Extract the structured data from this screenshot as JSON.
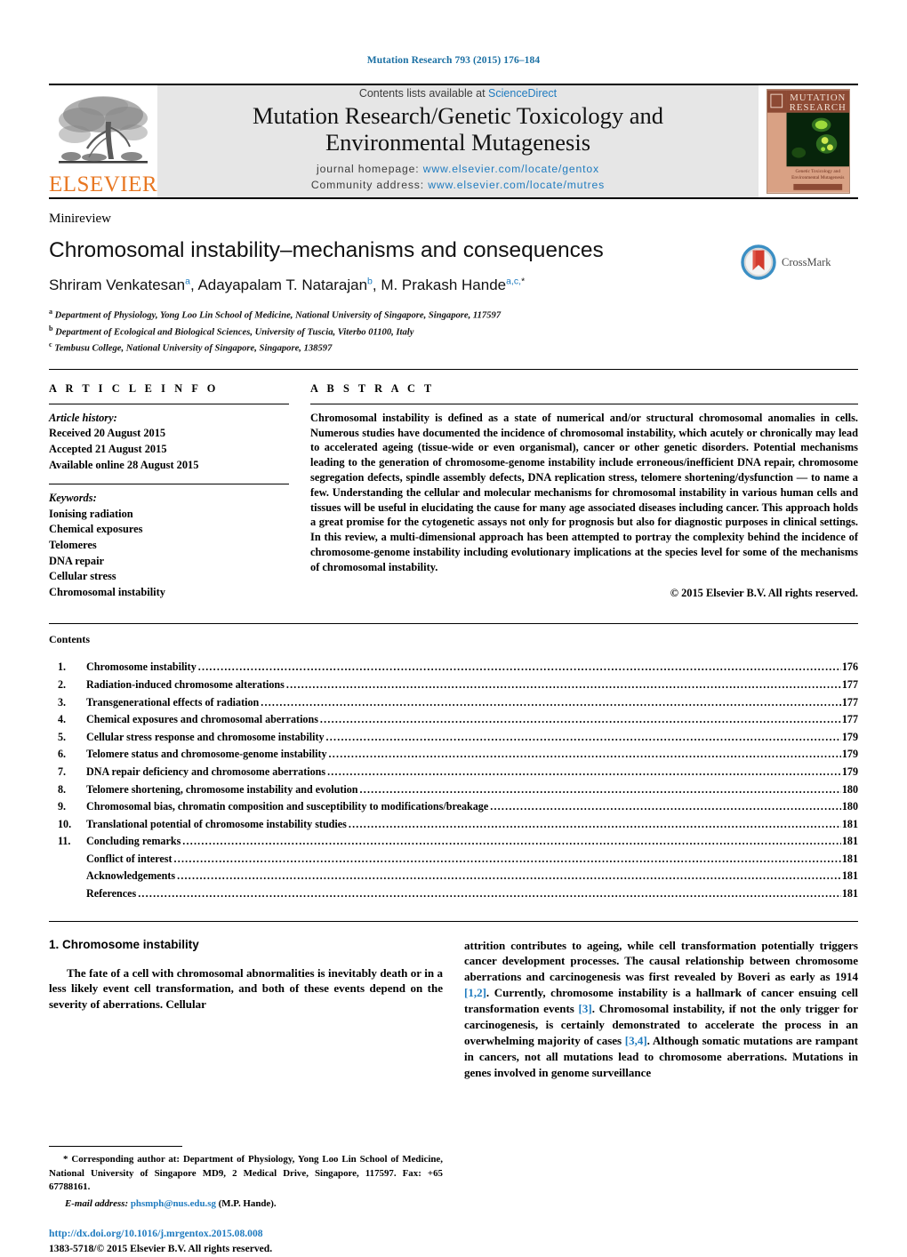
{
  "running_head": "Mutation Research 793 (2015) 176–184",
  "masthead": {
    "publisher_name": "ELSEVIER",
    "contents_prefix": "Contents lists available at ",
    "contents_link": "ScienceDirect",
    "journal_title_line1": "Mutation Research/Genetic Toxicology and",
    "journal_title_line2": "Environmental Mutagenesis",
    "homepage_label": "journal homepage:",
    "homepage_url": "www.elsevier.com/locate/gentox",
    "community_label": "Community address:",
    "community_url": "www.elsevier.com/locate/mutres",
    "cover_title_line1": "MUTATION",
    "cover_title_line2": "RESEARCH",
    "cover_sub_line1": "Genetic Toxicology and",
    "cover_sub_line2": "Environmental Mutagenesis"
  },
  "article": {
    "type_label": "Minireview",
    "title": "Chromosomal instability–mechanisms and consequences",
    "authors": [
      {
        "name": "Shriram Venkatesan",
        "marks": "a",
        "sep": ", "
      },
      {
        "name": "Adayapalam T. Natarajan",
        "marks": "b",
        "sep": ", "
      },
      {
        "name": "M. Prakash Hande",
        "marks": "a,c,",
        "star": "*",
        "sep": ""
      }
    ],
    "affiliations": [
      {
        "mark": "a",
        "text": "Department of Physiology, Yong Loo Lin School of Medicine, National University of Singapore, Singapore, 117597"
      },
      {
        "mark": "b",
        "text": "Department of Ecological and Biological Sciences, University of Tuscia, Viterbo 01100, Italy"
      },
      {
        "mark": "c",
        "text": "Tembusu College, National University of Singapore, Singapore, 138597"
      }
    ],
    "crossmark_label": "CrossMark"
  },
  "article_info": {
    "heading": "A R T I C L E    I N F O",
    "history_label": "Article history:",
    "history": [
      "Received 20 August 2015",
      "Accepted 21 August 2015",
      "Available online 28 August 2015"
    ],
    "keywords_label": "Keywords:",
    "keywords": [
      "Ionising radiation",
      "Chemical exposures",
      "Telomeres",
      "DNA repair",
      "Cellular stress",
      "Chromosomal instability"
    ]
  },
  "abstract": {
    "heading": "A B S T R A C T",
    "text": "Chromosomal instability is defined as a state of numerical and/or structural chromosomal anomalies in cells. Numerous studies have documented the incidence of chromosomal instability, which acutely or chronically may lead to accelerated ageing (tissue-wide or even organismal), cancer or other genetic disorders. Potential mechanisms leading to the generation of chromosome-genome instability include erroneous/inefficient DNA repair, chromosome segregation defects, spindle assembly defects, DNA replication stress, telomere shortening/dysfunction — to name a few. Understanding the cellular and molecular mechanisms for chromosomal instability in various human cells and tissues will be useful in elucidating the cause for many age associated diseases including cancer. This approach holds a great promise for the cytogenetic assays not only for prognosis but also for diagnostic purposes in clinical settings. In this review, a multi-dimensional approach has been attempted to portray the complexity behind the incidence of chromosome-genome instability including evolutionary implications at the species level for some of the mechanisms of chromosomal instability.",
    "copyright": "© 2015 Elsevier B.V. All rights reserved."
  },
  "contents": {
    "heading": "Contents",
    "entries": [
      {
        "num": "1.",
        "label": "Chromosome instability",
        "page": "176"
      },
      {
        "num": "2.",
        "label": "Radiation-induced chromosome alterations",
        "page": "177"
      },
      {
        "num": "3.",
        "label": "Transgenerational effects of radiation",
        "page": "177"
      },
      {
        "num": "4.",
        "label": "Chemical exposures and chromosomal aberrations",
        "page": "177"
      },
      {
        "num": "5.",
        "label": "Cellular stress response and chromosome instability",
        "page": "179"
      },
      {
        "num": "6.",
        "label": "Telomere status and chromosome-genome instability",
        "page": "179"
      },
      {
        "num": "7.",
        "label": "DNA repair deficiency and chromosome aberrations",
        "page": "179"
      },
      {
        "num": "8.",
        "label": "Telomere shortening, chromosome instability and evolution",
        "page": "180"
      },
      {
        "num": "9.",
        "label": "Chromosomal bias, chromatin composition and susceptibility to modifications/breakage",
        "page": "180"
      },
      {
        "num": "10.",
        "label": "Translational potential of chromosome instability studies",
        "page": "181"
      },
      {
        "num": "11.",
        "label": "Concluding remarks",
        "page": "181"
      },
      {
        "num": "",
        "label": "Conflict of interest",
        "page": "181"
      },
      {
        "num": "",
        "label": "Acknowledgements",
        "page": "181"
      },
      {
        "num": "",
        "label": "References",
        "page": "181"
      }
    ]
  },
  "body": {
    "section_heading": "1. Chromosome instability",
    "left_paragraph": "The fate of a cell with chromosomal abnormalities is inevitably death or in a less likely event cell transformation, and both of these events depend on the severity of aberrations. Cellular",
    "right_paragraph_parts": [
      {
        "t": "attrition contributes to ageing, while cell transformation potentially triggers cancer development processes. The causal relationship between chromosome aberrations and carcinogenesis was first revealed by Boveri as early as 1914 ",
        "ref": false
      },
      {
        "t": "[1,2]",
        "ref": true
      },
      {
        "t": ". Currently, chromosome instability is a hallmark of cancer ensuing cell transformation events ",
        "ref": false
      },
      {
        "t": "[3]",
        "ref": true
      },
      {
        "t": ". Chromosomal instability, if not the only trigger for carcinogenesis, is certainly demonstrated to accelerate the process in an overwhelming majority of cases ",
        "ref": false
      },
      {
        "t": "[3,4]",
        "ref": true
      },
      {
        "t": ". Although somatic mutations are rampant in cancers, not all mutations lead to chromosome aberrations. Mutations in genes involved in genome surveillance",
        "ref": false
      }
    ]
  },
  "footnote": {
    "corresponding": "* Corresponding author at: Department of Physiology, Yong Loo Lin School of Medicine, National University of Singapore MD9, 2 Medical Drive, Singapore, 117597. Fax: +65 67788161.",
    "email_label": "E-mail address:",
    "email": "phsmph@nus.edu.sg",
    "email_suffix": "(M.P. Hande).",
    "doi": "http://dx.doi.org/10.1016/j.mrgentox.2015.08.008",
    "issn_line": "1383-5718/© 2015 Elsevier B.V. All rights reserved."
  }
}
